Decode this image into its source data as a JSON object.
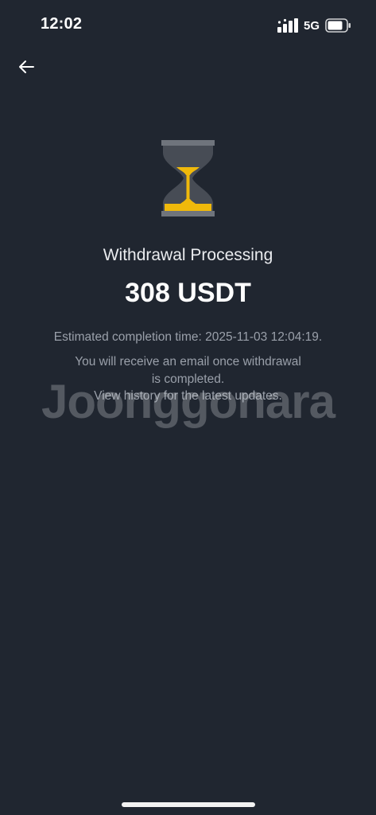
{
  "status_bar": {
    "time": "12:02",
    "network": "5G",
    "icons": [
      "signal-icon",
      "battery-icon"
    ]
  },
  "nav": {
    "back_icon": "arrow-left-icon"
  },
  "status_icon": "hourglass-icon",
  "withdrawal": {
    "title": "Withdrawal Processing",
    "amount": "308 USDT",
    "estimate": "Estimated completion time: 2025-11-03 12:04:19.",
    "info_line1": "You will receive an email once withdrawal",
    "info_line2": "is completed.",
    "info_line3": "View history for the latest updates."
  },
  "watermark": "Joonggonara",
  "colors": {
    "background": "#202630",
    "accent": "#f0b90b",
    "muted_text": "#9aa0aa"
  }
}
